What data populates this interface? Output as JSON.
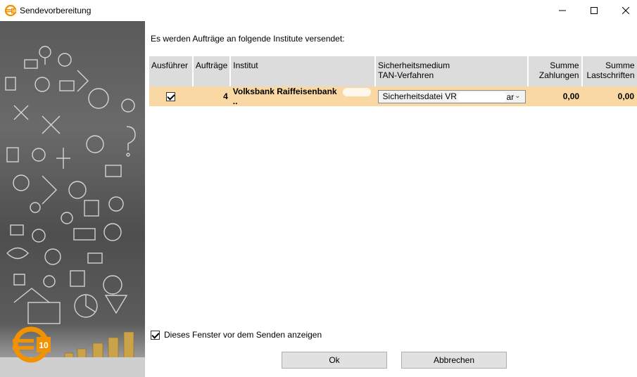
{
  "window": {
    "title": "Sendevorbereitung",
    "brand_color": "#f39200"
  },
  "main": {
    "intro": "Es werden Aufträge an folgende Institute versendet:",
    "columns": {
      "executor": "Ausführer",
      "orders": "Aufträge",
      "institute": "Institut",
      "security_line1": "Sicherheitsmedium",
      "security_line2": "TAN-Verfahren",
      "payments_line1": "Summe",
      "payments_line2": "Zahlungen",
      "debits_line1": "Summe",
      "debits_line2": "Lastschriften"
    },
    "rows": [
      {
        "executor_checked": true,
        "orders": "4",
        "institute": "Volksbank Raiffeisenbank",
        "institute_suffix": "..",
        "security_medium": "Sicherheitsdatei VR",
        "security_suffix": "ar",
        "payments": "0,00",
        "debits": "0,00"
      }
    ],
    "show_before_send_label": "Dieses Fenster vor dem Senden anzeigen",
    "show_before_send_checked": true,
    "ok_label": "Ok",
    "cancel_label": "Abbrechen"
  },
  "side_image": {
    "logo_text": "10"
  },
  "colors": {
    "row_highlight": "#fad8a3",
    "header_bg": "#dcdcdc",
    "logo_orange": "#f39200"
  }
}
